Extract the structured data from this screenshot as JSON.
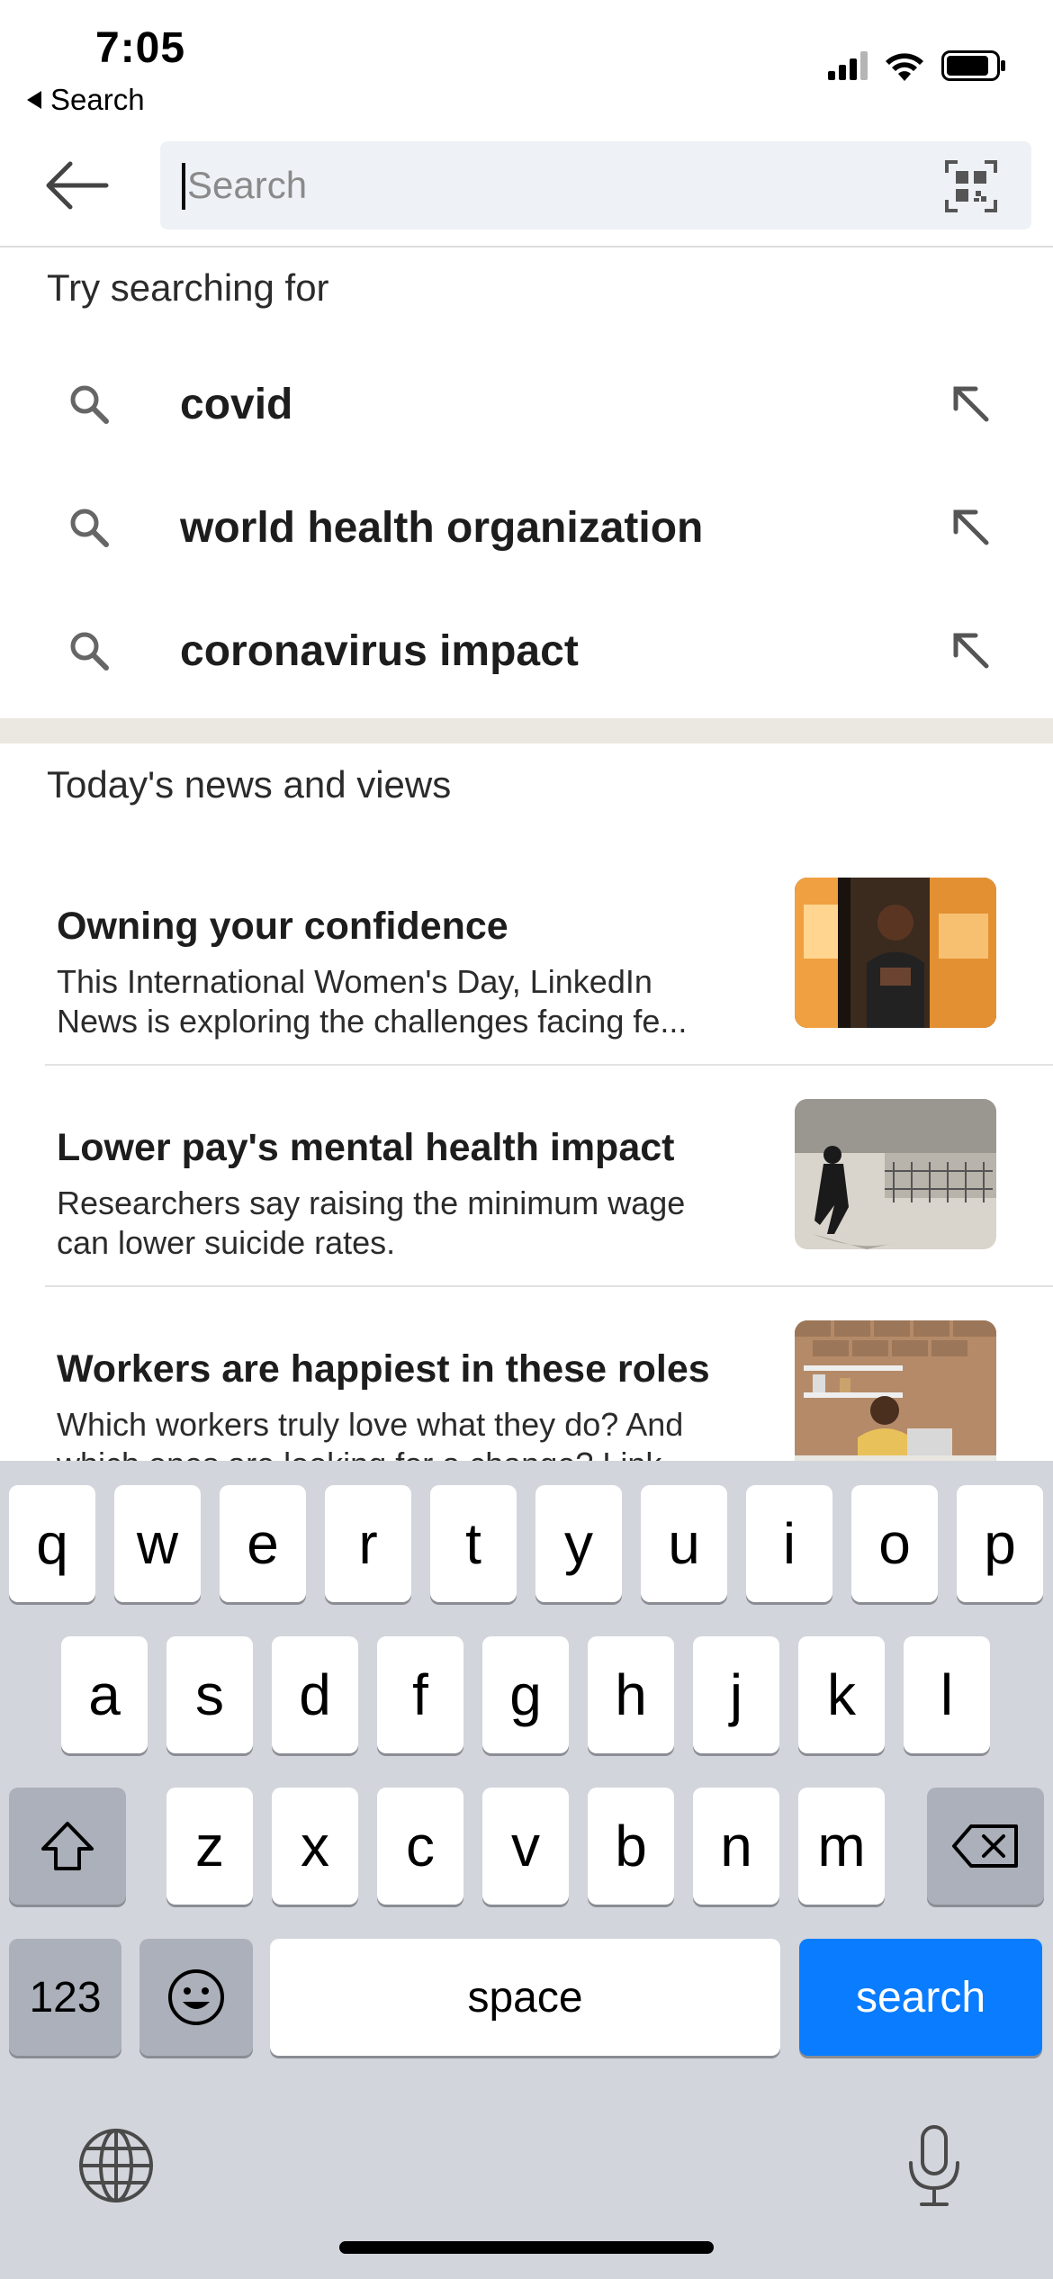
{
  "status_bar": {
    "time": "7:05",
    "back_app_label": "Search"
  },
  "search": {
    "placeholder": "Search"
  },
  "suggestions": {
    "heading": "Try searching for",
    "items": [
      {
        "label": "covid"
      },
      {
        "label": "world health organization"
      },
      {
        "label": "coronavirus impact"
      }
    ]
  },
  "news": {
    "heading": "Today's news and views",
    "items": [
      {
        "title": "Owning your confidence",
        "line1": "This International Women's Day, LinkedIn",
        "line2": "News is exploring the challenges facing fe..."
      },
      {
        "title": "Lower pay's mental health impact",
        "line1": "Researchers say raising the minimum wage",
        "line2": "can lower suicide rates."
      },
      {
        "title": "Workers are happiest in these roles",
        "line1": "Which workers truly love what they do? And",
        "line2": "which ones are looking for a change? Link..."
      }
    ]
  },
  "keyboard": {
    "row1": [
      "q",
      "w",
      "e",
      "r",
      "t",
      "y",
      "u",
      "i",
      "o",
      "p"
    ],
    "row2": [
      "a",
      "s",
      "d",
      "f",
      "g",
      "h",
      "j",
      "k",
      "l"
    ],
    "row3": [
      "z",
      "x",
      "c",
      "v",
      "b",
      "n",
      "m"
    ],
    "numbers_label": "123",
    "space_label": "space",
    "action_label": "search"
  },
  "colors": {
    "accent": "#0a7cff",
    "search_bg": "#eef2f6",
    "keyboard_bg": "#d2d5db",
    "band": "#ebe7e1"
  }
}
